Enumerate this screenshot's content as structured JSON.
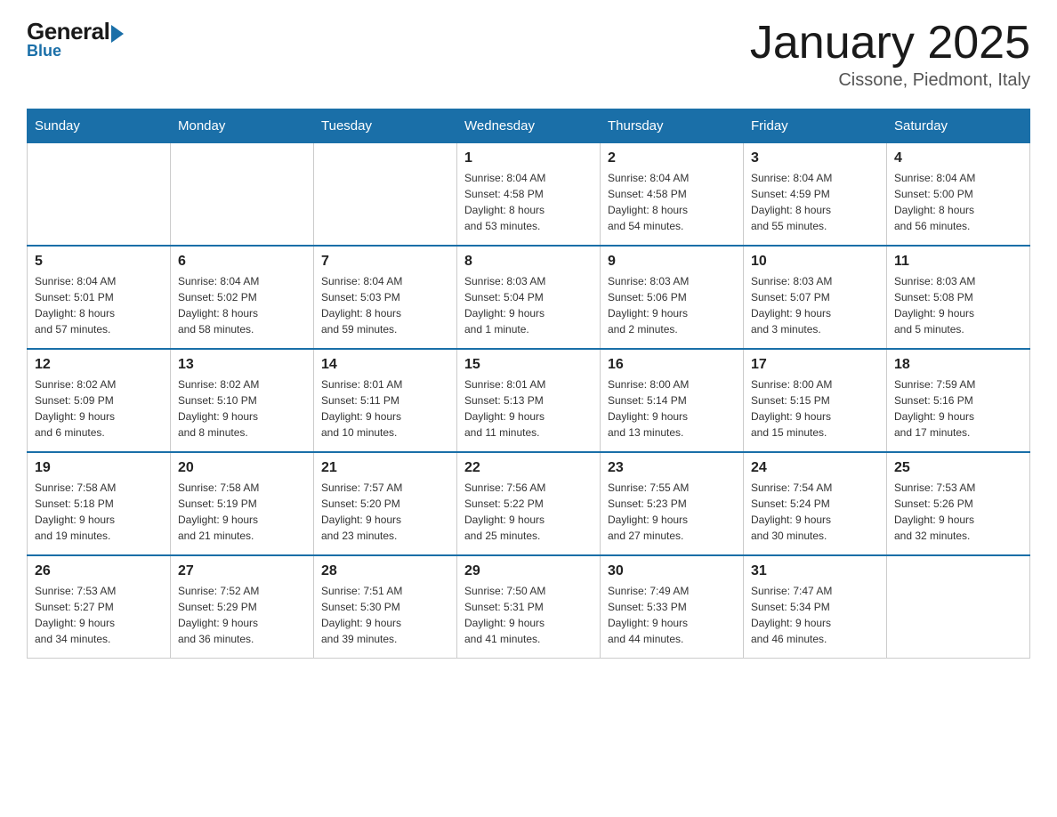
{
  "logo": {
    "general": "General",
    "blue": "Blue"
  },
  "title": "January 2025",
  "location": "Cissone, Piedmont, Italy",
  "days_of_week": [
    "Sunday",
    "Monday",
    "Tuesday",
    "Wednesday",
    "Thursday",
    "Friday",
    "Saturday"
  ],
  "weeks": [
    [
      {
        "day": "",
        "info": ""
      },
      {
        "day": "",
        "info": ""
      },
      {
        "day": "",
        "info": ""
      },
      {
        "day": "1",
        "info": "Sunrise: 8:04 AM\nSunset: 4:58 PM\nDaylight: 8 hours\nand 53 minutes."
      },
      {
        "day": "2",
        "info": "Sunrise: 8:04 AM\nSunset: 4:58 PM\nDaylight: 8 hours\nand 54 minutes."
      },
      {
        "day": "3",
        "info": "Sunrise: 8:04 AM\nSunset: 4:59 PM\nDaylight: 8 hours\nand 55 minutes."
      },
      {
        "day": "4",
        "info": "Sunrise: 8:04 AM\nSunset: 5:00 PM\nDaylight: 8 hours\nand 56 minutes."
      }
    ],
    [
      {
        "day": "5",
        "info": "Sunrise: 8:04 AM\nSunset: 5:01 PM\nDaylight: 8 hours\nand 57 minutes."
      },
      {
        "day": "6",
        "info": "Sunrise: 8:04 AM\nSunset: 5:02 PM\nDaylight: 8 hours\nand 58 minutes."
      },
      {
        "day": "7",
        "info": "Sunrise: 8:04 AM\nSunset: 5:03 PM\nDaylight: 8 hours\nand 59 minutes."
      },
      {
        "day": "8",
        "info": "Sunrise: 8:03 AM\nSunset: 5:04 PM\nDaylight: 9 hours\nand 1 minute."
      },
      {
        "day": "9",
        "info": "Sunrise: 8:03 AM\nSunset: 5:06 PM\nDaylight: 9 hours\nand 2 minutes."
      },
      {
        "day": "10",
        "info": "Sunrise: 8:03 AM\nSunset: 5:07 PM\nDaylight: 9 hours\nand 3 minutes."
      },
      {
        "day": "11",
        "info": "Sunrise: 8:03 AM\nSunset: 5:08 PM\nDaylight: 9 hours\nand 5 minutes."
      }
    ],
    [
      {
        "day": "12",
        "info": "Sunrise: 8:02 AM\nSunset: 5:09 PM\nDaylight: 9 hours\nand 6 minutes."
      },
      {
        "day": "13",
        "info": "Sunrise: 8:02 AM\nSunset: 5:10 PM\nDaylight: 9 hours\nand 8 minutes."
      },
      {
        "day": "14",
        "info": "Sunrise: 8:01 AM\nSunset: 5:11 PM\nDaylight: 9 hours\nand 10 minutes."
      },
      {
        "day": "15",
        "info": "Sunrise: 8:01 AM\nSunset: 5:13 PM\nDaylight: 9 hours\nand 11 minutes."
      },
      {
        "day": "16",
        "info": "Sunrise: 8:00 AM\nSunset: 5:14 PM\nDaylight: 9 hours\nand 13 minutes."
      },
      {
        "day": "17",
        "info": "Sunrise: 8:00 AM\nSunset: 5:15 PM\nDaylight: 9 hours\nand 15 minutes."
      },
      {
        "day": "18",
        "info": "Sunrise: 7:59 AM\nSunset: 5:16 PM\nDaylight: 9 hours\nand 17 minutes."
      }
    ],
    [
      {
        "day": "19",
        "info": "Sunrise: 7:58 AM\nSunset: 5:18 PM\nDaylight: 9 hours\nand 19 minutes."
      },
      {
        "day": "20",
        "info": "Sunrise: 7:58 AM\nSunset: 5:19 PM\nDaylight: 9 hours\nand 21 minutes."
      },
      {
        "day": "21",
        "info": "Sunrise: 7:57 AM\nSunset: 5:20 PM\nDaylight: 9 hours\nand 23 minutes."
      },
      {
        "day": "22",
        "info": "Sunrise: 7:56 AM\nSunset: 5:22 PM\nDaylight: 9 hours\nand 25 minutes."
      },
      {
        "day": "23",
        "info": "Sunrise: 7:55 AM\nSunset: 5:23 PM\nDaylight: 9 hours\nand 27 minutes."
      },
      {
        "day": "24",
        "info": "Sunrise: 7:54 AM\nSunset: 5:24 PM\nDaylight: 9 hours\nand 30 minutes."
      },
      {
        "day": "25",
        "info": "Sunrise: 7:53 AM\nSunset: 5:26 PM\nDaylight: 9 hours\nand 32 minutes."
      }
    ],
    [
      {
        "day": "26",
        "info": "Sunrise: 7:53 AM\nSunset: 5:27 PM\nDaylight: 9 hours\nand 34 minutes."
      },
      {
        "day": "27",
        "info": "Sunrise: 7:52 AM\nSunset: 5:29 PM\nDaylight: 9 hours\nand 36 minutes."
      },
      {
        "day": "28",
        "info": "Sunrise: 7:51 AM\nSunset: 5:30 PM\nDaylight: 9 hours\nand 39 minutes."
      },
      {
        "day": "29",
        "info": "Sunrise: 7:50 AM\nSunset: 5:31 PM\nDaylight: 9 hours\nand 41 minutes."
      },
      {
        "day": "30",
        "info": "Sunrise: 7:49 AM\nSunset: 5:33 PM\nDaylight: 9 hours\nand 44 minutes."
      },
      {
        "day": "31",
        "info": "Sunrise: 7:47 AM\nSunset: 5:34 PM\nDaylight: 9 hours\nand 46 minutes."
      },
      {
        "day": "",
        "info": ""
      }
    ]
  ]
}
